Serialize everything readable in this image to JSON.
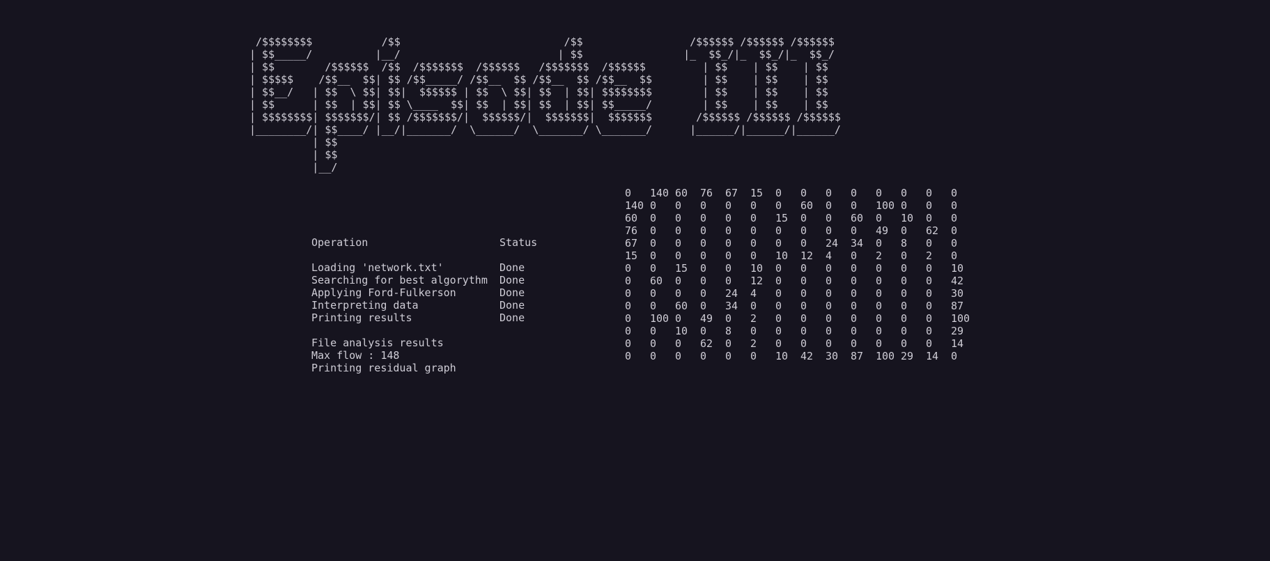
{
  "banner": {
    "lines": [
      " /$$$$$$$$           /$$                          /$$                 /$$$$$$ /$$$$$$ /$$$$$$",
      "| $$_____/          |__/                         | $$                |_  $$_/|_  $$_/|_  $$_/",
      "| $$        /$$$$$$  /$$  /$$$$$$$  /$$$$$$   /$$$$$$$  /$$$$$$         | $$    | $$    | $$  ",
      "| $$$$$    /$$__  $$| $$ /$$_____/ /$$__  $$ /$$__  $$ /$$__  $$        | $$    | $$    | $$  ",
      "| $$__/   | $$  \\ $$| $$|  $$$$$$ | $$  \\ $$| $$  | $$| $$$$$$$$        | $$    | $$    | $$  ",
      "| $$      | $$  | $$| $$ \\____  $$| $$  | $$| $$  | $$| $$_____/        | $$    | $$    | $$  ",
      "| $$$$$$$$| $$$$$$$/| $$ /$$$$$$$/|  $$$$$$/|  $$$$$$$|  $$$$$$$       /$$$$$$ /$$$$$$ /$$$$$$",
      "|________/| $$____/ |__/|_______/  \\______/  \\_______/ \\_______/      |______/|______/|______/",
      "          | $$",
      "          | $$",
      "          |__/"
    ]
  },
  "table": {
    "header": {
      "operation": "Operation",
      "status": "Status"
    },
    "rows": [
      {
        "operation": "Loading 'network.txt'",
        "status": "Done"
      },
      {
        "operation": "Searching for best algorythm",
        "status": "Done"
      },
      {
        "operation": "Applying Ford-Fulkerson",
        "status": "Done"
      },
      {
        "operation": "Interpreting data",
        "status": "Done"
      },
      {
        "operation": "Printing results",
        "status": "Done"
      }
    ]
  },
  "results": {
    "title": "File analysis results",
    "max_flow": "Max flow : 148",
    "residual": "Printing residual graph"
  },
  "matrix": [
    [
      "0",
      "140",
      "60",
      "76",
      "67",
      "15",
      "0",
      "0",
      "0",
      "0",
      "0",
      "0",
      "0",
      "0"
    ],
    [
      "140",
      "0",
      "0",
      "0",
      "0",
      "0",
      "0",
      "60",
      "0",
      "0",
      "100",
      "0",
      "0",
      "0"
    ],
    [
      "60",
      "0",
      "0",
      "0",
      "0",
      "0",
      "15",
      "0",
      "0",
      "60",
      "0",
      "10",
      "0",
      "0"
    ],
    [
      "76",
      "0",
      "0",
      "0",
      "0",
      "0",
      "0",
      "0",
      "0",
      "0",
      "49",
      "0",
      "62",
      "0"
    ],
    [
      "67",
      "0",
      "0",
      "0",
      "0",
      "0",
      "0",
      "0",
      "24",
      "34",
      "0",
      "8",
      "0",
      "0"
    ],
    [
      "15",
      "0",
      "0",
      "0",
      "0",
      "0",
      "10",
      "12",
      "4",
      "0",
      "2",
      "0",
      "2",
      "0"
    ],
    [
      "0",
      "0",
      "15",
      "0",
      "0",
      "10",
      "0",
      "0",
      "0",
      "0",
      "0",
      "0",
      "0",
      "10"
    ],
    [
      "0",
      "60",
      "0",
      "0",
      "0",
      "12",
      "0",
      "0",
      "0",
      "0",
      "0",
      "0",
      "0",
      "42"
    ],
    [
      "0",
      "0",
      "0",
      "0",
      "24",
      "4",
      "0",
      "0",
      "0",
      "0",
      "0",
      "0",
      "0",
      "30"
    ],
    [
      "0",
      "0",
      "60",
      "0",
      "34",
      "0",
      "0",
      "0",
      "0",
      "0",
      "0",
      "0",
      "0",
      "87"
    ],
    [
      "0",
      "100",
      "0",
      "49",
      "0",
      "2",
      "0",
      "0",
      "0",
      "0",
      "0",
      "0",
      "0",
      "100"
    ],
    [
      "0",
      "0",
      "10",
      "0",
      "8",
      "0",
      "0",
      "0",
      "0",
      "0",
      "0",
      "0",
      "0",
      "29"
    ],
    [
      "0",
      "0",
      "0",
      "62",
      "0",
      "2",
      "0",
      "0",
      "0",
      "0",
      "0",
      "0",
      "0",
      "14"
    ],
    [
      "0",
      "0",
      "0",
      "0",
      "0",
      "0",
      "10",
      "42",
      "30",
      "87",
      "100",
      "29",
      "14",
      "0"
    ]
  ]
}
